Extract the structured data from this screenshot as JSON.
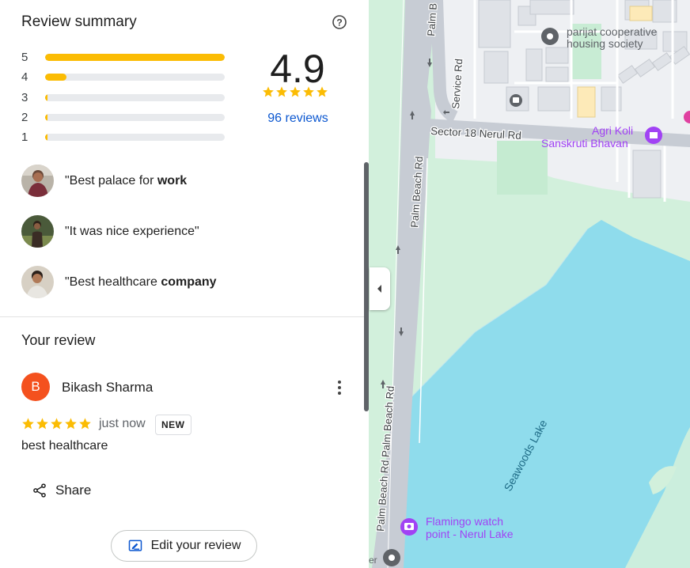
{
  "review_summary": {
    "title": "Review summary",
    "distribution": [
      {
        "stars": "5",
        "fraction": 1.0
      },
      {
        "stars": "4",
        "fraction": 0.12
      },
      {
        "stars": "3",
        "fraction": 0.01
      },
      {
        "stars": "2",
        "fraction": 0.01
      },
      {
        "stars": "1",
        "fraction": 0.01
      }
    ],
    "rating": "4.9",
    "reviews_link": "96 reviews"
  },
  "snippets": [
    {
      "prefix": "\"Best palace for ",
      "bold": "work",
      "suffix": ""
    },
    {
      "prefix": "\"It was nice experience\"",
      "bold": "",
      "suffix": ""
    },
    {
      "prefix": "\"Best healthcare ",
      "bold": "company",
      "suffix": ""
    }
  ],
  "your_review": {
    "title": "Your review",
    "user_initial": "B",
    "user_name": "Bikash Sharma",
    "time": "just now",
    "badge": "NEW",
    "text": "best healthcare",
    "share_label": "Share",
    "edit_label": "Edit your review"
  },
  "map": {
    "labels": {
      "palm_beach_1": "Palm Beach Rd",
      "palm_beach_2": "Palm Beach Rd Palm Beach Rd",
      "palm_top": "Palm B",
      "service_rd": "Service Rd",
      "sector18": "Sector 18 Nerul Rd",
      "parijat_1": "parijat cooperative",
      "parijat_2": "housing society",
      "agri_1": "Agri Koli",
      "agri_2": "Sanskruti Bhavan",
      "lake": "Seawoods Lake",
      "flamingo_1": "Flamingo watch",
      "flamingo_2": "point - Nerul Lake",
      "edge": "er"
    }
  },
  "colors": {
    "star": "#fbbc04",
    "link": "#0b57d0",
    "avatar": "#f4511e",
    "lake": "#8fdcec",
    "park": "#d4f4df",
    "poi_purple": "#a142f4"
  }
}
